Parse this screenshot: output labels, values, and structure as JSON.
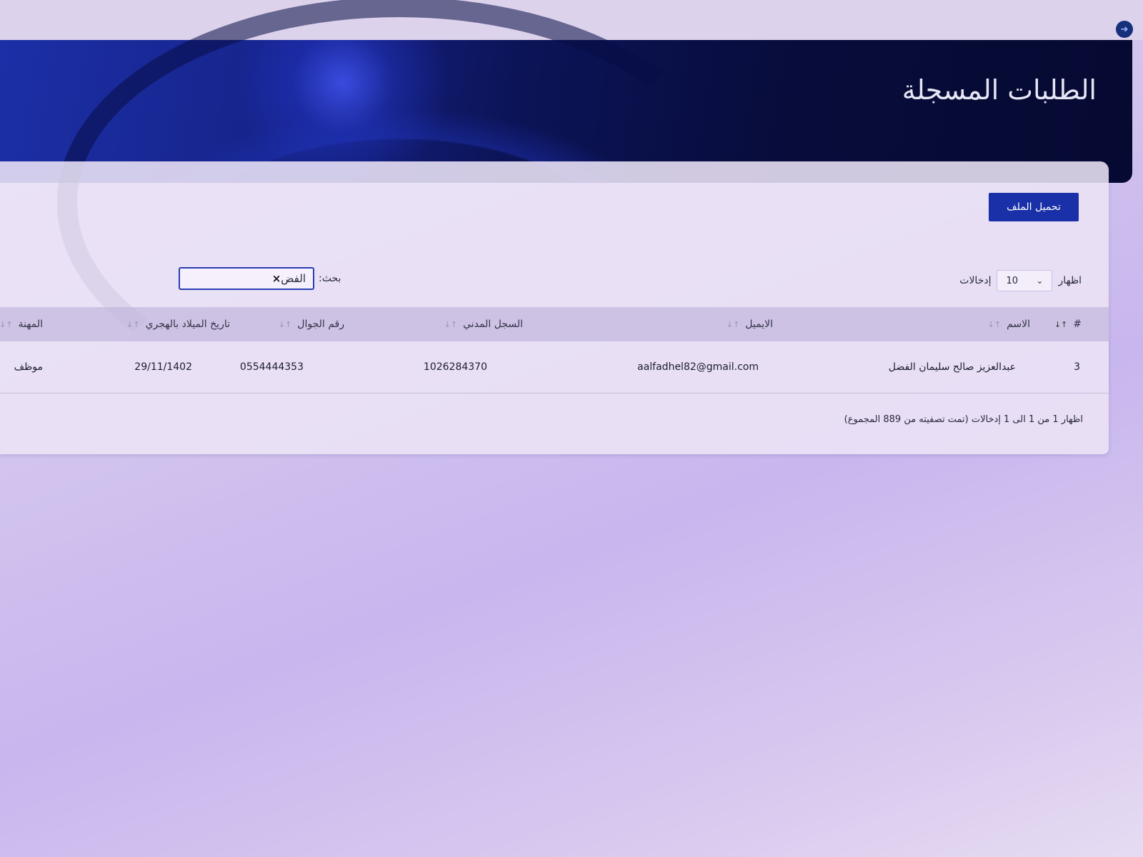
{
  "header": {
    "title": "الطلبات المسجلة",
    "corner_icon": "arrow-right-circle-icon"
  },
  "toolbar": {
    "download_label": "تحميل الملف"
  },
  "length": {
    "prefix": "اظهار",
    "value": "10",
    "suffix": "إدخالات",
    "chevron": "⌄"
  },
  "search": {
    "label": "بحث:",
    "value": "الفض",
    "clear": "×"
  },
  "table": {
    "columns": [
      {
        "label": "#",
        "sort_icon": "↑↓"
      },
      {
        "label": "الاسم",
        "sort_icon": "↑↓"
      },
      {
        "label": "الايميل",
        "sort_icon": "↑↓"
      },
      {
        "label": "السجل المدني",
        "sort_icon": "↑↓"
      },
      {
        "label": "رقم الجوال",
        "sort_icon": "↑↓"
      },
      {
        "label": "تاريخ الميلاد بالهجري",
        "sort_icon": "↑↓"
      },
      {
        "label": "المهنة",
        "sort_icon": "↑↓"
      }
    ],
    "rows": [
      [
        "3",
        "عبدالعزيز صالح سليمان الفضل",
        "aalfadhel82@gmail.com",
        "1026284370",
        "0554444353",
        "29/11/1402",
        "موظف"
      ]
    ]
  },
  "info": {
    "text": "اظهار 1 من 1 الى 1 إدخالات (تمت تصفيته من 889 المجموع)"
  },
  "colors": {
    "banner": "#0c1458",
    "primary_button": "#1930a8",
    "background": "#d3c5ee"
  }
}
